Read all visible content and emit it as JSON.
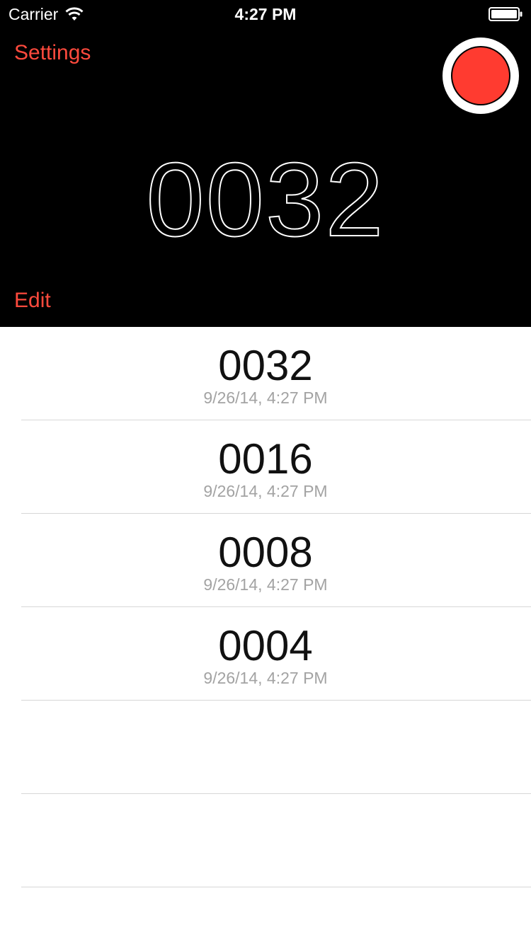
{
  "status_bar": {
    "carrier": "Carrier",
    "time": "4:27 PM"
  },
  "header": {
    "settings_label": "Settings",
    "counter": "0032",
    "edit_label": "Edit",
    "accent_color": "#ff4a3d",
    "record_color": "#ff3b30"
  },
  "recordings": [
    {
      "count": "0032",
      "timestamp": "9/26/14, 4:27 PM"
    },
    {
      "count": "0016",
      "timestamp": "9/26/14, 4:27 PM"
    },
    {
      "count": "0008",
      "timestamp": "9/26/14, 4:27 PM"
    },
    {
      "count": "0004",
      "timestamp": "9/26/14, 4:27 PM"
    },
    {
      "count": "",
      "timestamp": ""
    },
    {
      "count": "",
      "timestamp": ""
    }
  ]
}
